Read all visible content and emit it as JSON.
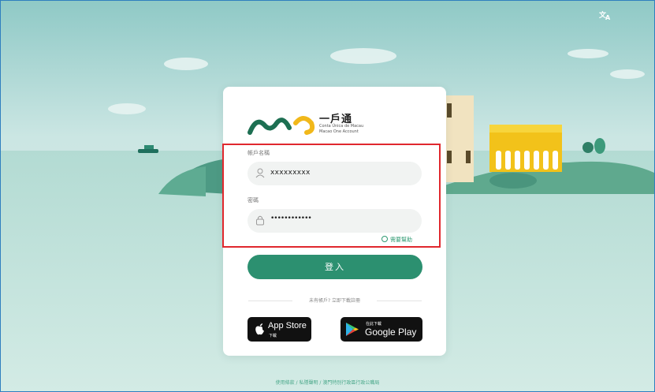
{
  "brand": {
    "name": "一戶通",
    "subtitle_pt": "Conta Única de Macau",
    "subtitle_en": "Macao One Account"
  },
  "login": {
    "username_label": "帳戶名稱",
    "username_value": "xxxxxxxxx",
    "password_label": "密碼",
    "password_value": "••••••••••••",
    "help_link": "需要幫助",
    "submit_label": "登入"
  },
  "download": {
    "prompt": "未有帳戶? 立即下載註冊",
    "app_store": {
      "top": "App Store",
      "bottom": "下載"
    },
    "google_play": {
      "top": "在此下載",
      "bottom": "Google Play"
    }
  },
  "footer": {
    "terms": "使用條款",
    "privacy": "私隱聲明",
    "gov": "澳門特別行政區行政公職局",
    "separator": " / "
  },
  "icons": {
    "translate": "translate-icon",
    "user": "user-icon",
    "lock": "lock-icon",
    "clock": "clock-icon",
    "apple": "apple-icon",
    "google_play": "google-play-icon"
  },
  "colors": {
    "accent": "#2c9070",
    "highlight": "#e0282e",
    "sky": "#cde6e4",
    "sea": "#a9d6cd"
  }
}
